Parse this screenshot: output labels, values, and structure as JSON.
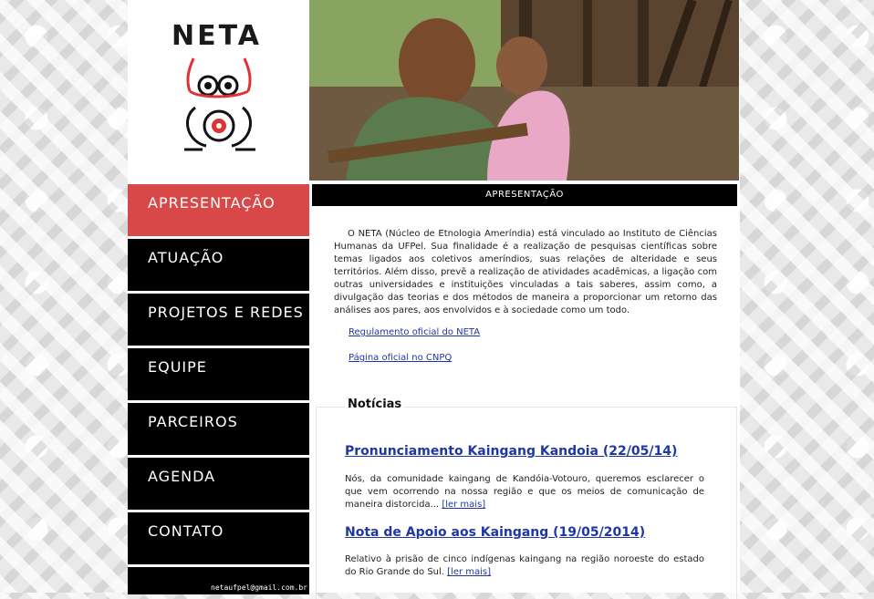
{
  "logo": {
    "text": "NETA"
  },
  "nav": {
    "items": [
      {
        "label": "APRESENTAÇÃO",
        "active": true
      },
      {
        "label": "ATUAÇÃO"
      },
      {
        "label": "PROJETOS E REDES"
      },
      {
        "label": "EQUIPE"
      },
      {
        "label": "PARCEIROS"
      },
      {
        "label": "AGENDA"
      },
      {
        "label": "CONTATO"
      }
    ],
    "email": "netaufpel@gmail.com.br"
  },
  "main": {
    "section_title": "APRESENTAÇÃO",
    "intro": "O NETA (Núcleo de Etnologia Ameríndia) está vinculado ao Instituto de Ciências Humanas da UFPel. Sua finalidade é a realização de pesquisas científicas sobre temas ligados aos coletivos ameríndios, suas relações de alteridade e seus territórios. Além disso, prevê a realização de atividades acadêmicas, a ligação com outras universidades e instituições vinculadas a tais saberes, assim como, a divulgação das teorias e dos métodos de maneira a proporcionar um retorno das análises aos pares, aos envolvidos e à sociedade como um todo.",
    "links": [
      "Regulamento oficial do NETA",
      "Página oficial no CNPQ"
    ]
  },
  "news": {
    "title": "Notícias",
    "items": [
      {
        "headline": "Pronunciamento Kaingang Kandoia (22/05/14)",
        "body": "Nós, da comunidade kaingang de Kandóia-Votouro, queremos esclarecer o que vem ocorrendo na nossa região e que os meios de comunicação de maneira distorcida...",
        "more": "[ler mais]"
      },
      {
        "headline": "Nota de Apoio aos Kaingang (19/05/2014)",
        "body": "Relativo à prisão de cinco indígenas kaingang na região noroeste do estado do Rio Grande do Sul.",
        "more": "[ler mais]"
      }
    ]
  },
  "colors": {
    "accent": "#d84848",
    "link": "#1f37a6",
    "nav_bg": "#000000"
  }
}
